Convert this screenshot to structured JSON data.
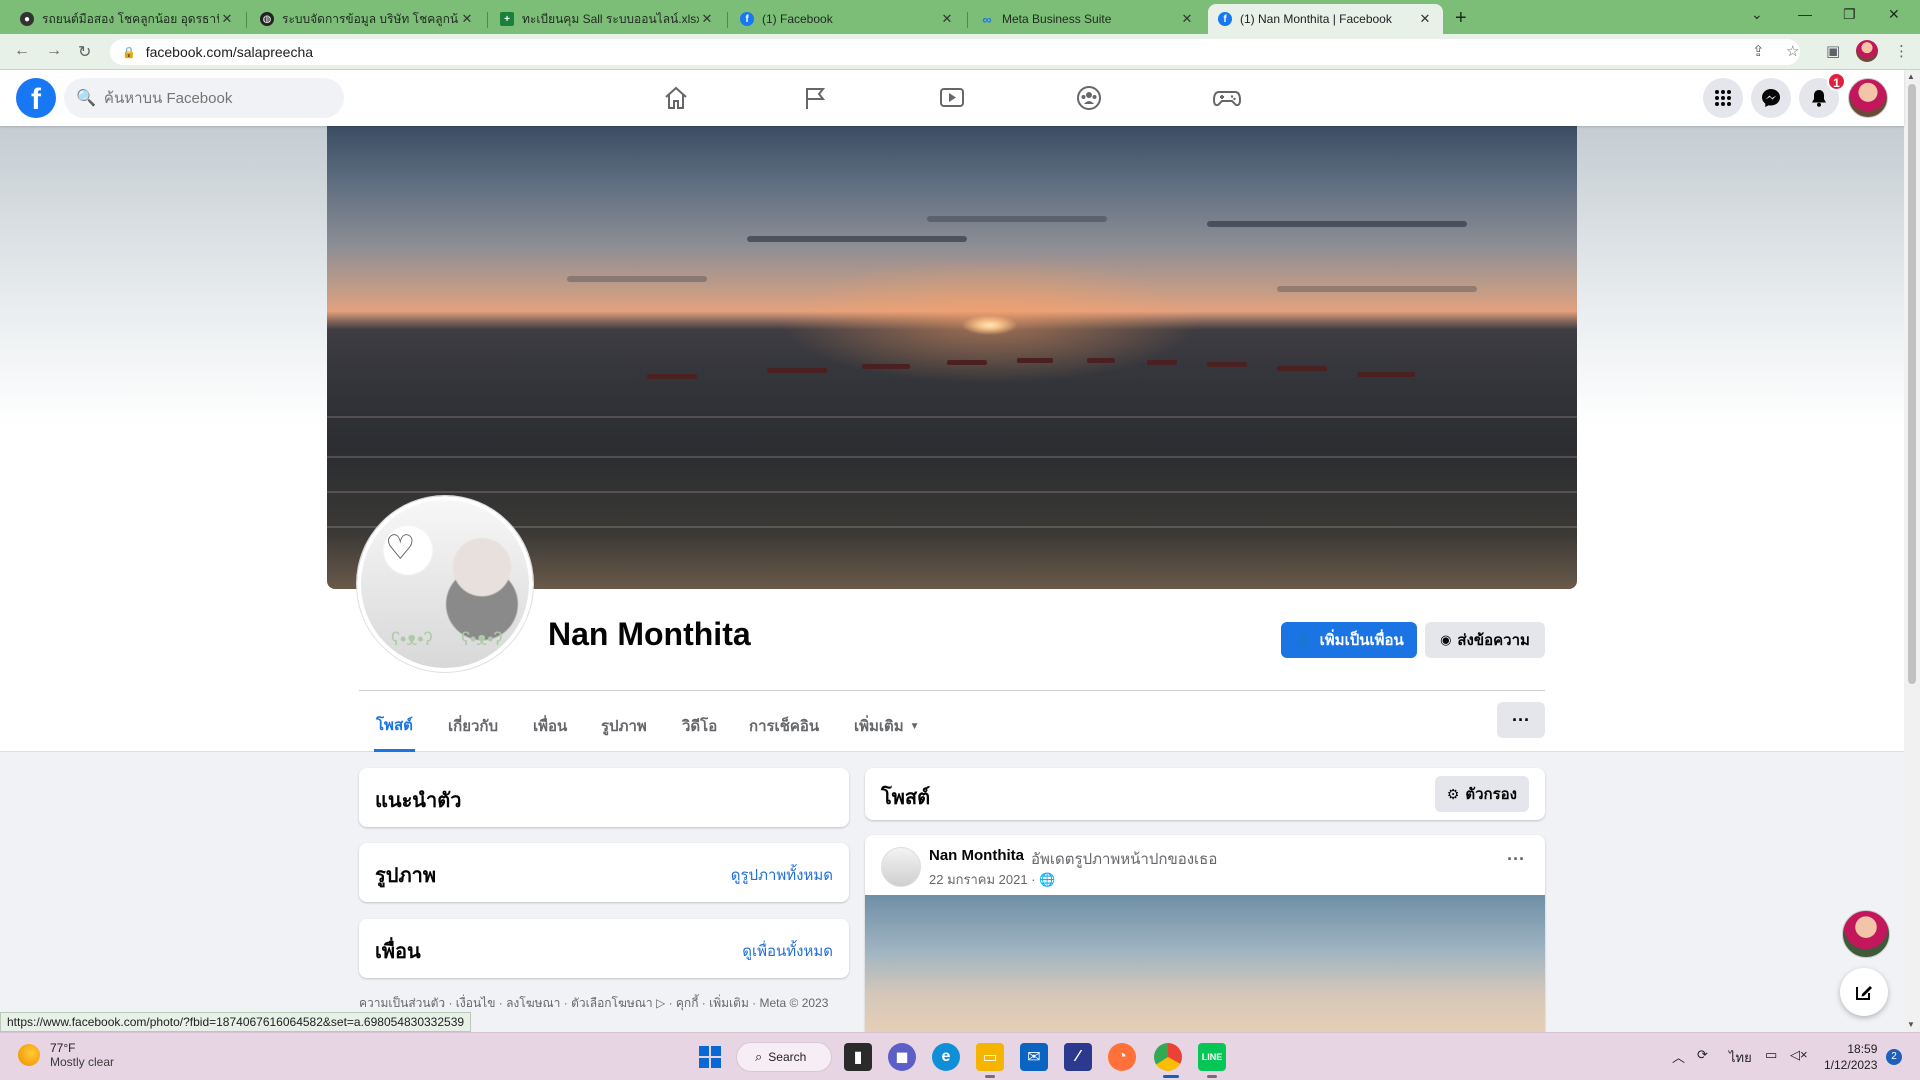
{
  "browser": {
    "tabs": [
      {
        "title": "รถยนต์มือสอง โชคลูกน้อย อุดรธานี",
        "favicon": "bear-favicon"
      },
      {
        "title": "ระบบจัดการข้อมูล บริษัท โชคลูกน้อย",
        "favicon": "globe-favicon"
      },
      {
        "title": "ทะเบียนคุม Sall ระบบออนไลน์.xlsx - G",
        "favicon": "sheets-favicon"
      },
      {
        "title": "(1) Facebook",
        "favicon": "facebook-favicon"
      },
      {
        "title": "Meta Business Suite",
        "favicon": "meta-favicon"
      },
      {
        "title": "(1) Nan Monthita | Facebook",
        "favicon": "facebook-favicon"
      }
    ],
    "new_tab": "+",
    "url": "facebook.com/salapreecha",
    "status_url": "https://www.facebook.com/photo/?fbid=1874067616064582&set=a.698054830332539"
  },
  "fb": {
    "search_placeholder": "ค้นหาบน Facebook",
    "notification_count": "1"
  },
  "profile": {
    "name": "Nan Monthita",
    "add_friend": "เพิ่มเป็นเพื่อน",
    "send_message": "ส่งข้อความ",
    "tabs": [
      "โพสต์",
      "เกี่ยวกับ",
      "เพื่อน",
      "รูปภาพ",
      "วิดีโอ",
      "การเช็คอิน",
      "เพิ่มเติม"
    ],
    "more_dots": "···"
  },
  "sidebar": {
    "intro_title": "แนะนำตัว",
    "photos_title": "รูปภาพ",
    "photos_link": "ดูรูปภาพทั้งหมด",
    "friends_title": "เพื่อน",
    "friends_link": "ดูเพื่อนทั้งหมด",
    "footer": "ความเป็นส่วนตัว · เงื่อนไข · ลงโฆษณา · ตัวเลือกโฆษณา ▷ · คุกกี้ · เพิ่มเติม · Meta © 2023"
  },
  "posts": {
    "title": "โพสต์",
    "filter": "ตัวกรอง",
    "post": {
      "author": "Nan Monthita",
      "action": "อัพเดตรูปภาพหน้าปกของเธอ",
      "date": "22 มกราคม 2021 · 🌐",
      "more": "···"
    }
  },
  "taskbar": {
    "weather_temp": "77°F",
    "weather_desc": "Mostly clear",
    "search": "Search",
    "lang": "ไทย",
    "time": "18:59",
    "date": "1/12/2023",
    "notif_count": "2"
  },
  "colors": {
    "accent": "#1b74e4",
    "tabbar": "#7cbd78",
    "taskbar": "#e8d5e3"
  }
}
